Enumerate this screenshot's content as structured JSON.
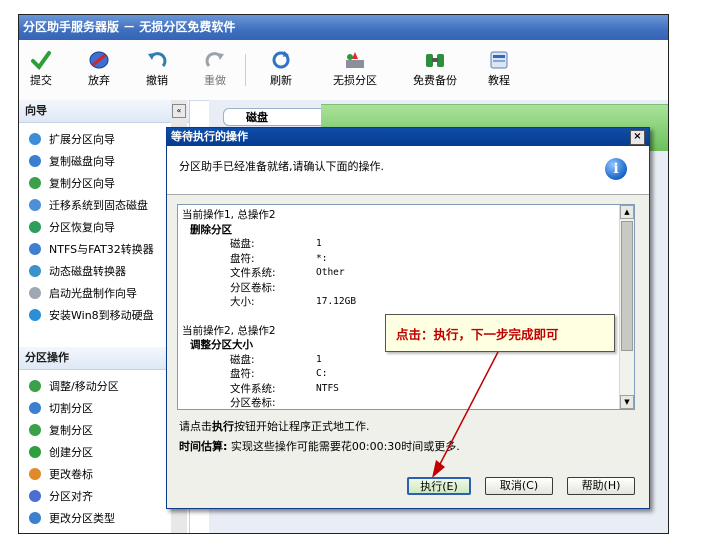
{
  "window": {
    "title": "分区助手服务器版 － 无损分区免费软件"
  },
  "toolbar": {
    "items": [
      {
        "label": "提交",
        "icon": "check-icon"
      },
      {
        "label": "放弃",
        "icon": "discard-icon"
      },
      {
        "label": "撤销",
        "icon": "undo-icon"
      },
      {
        "label": "重做",
        "icon": "redo-icon"
      },
      {
        "label": "刷新",
        "icon": "refresh-icon"
      },
      {
        "label": "无损分区",
        "icon": "partition-icon"
      },
      {
        "label": "免费备份",
        "icon": "backup-icon"
      },
      {
        "label": "教程",
        "icon": "tutorial-icon"
      }
    ]
  },
  "sidebar": {
    "wizard_header": "向导",
    "wizard_items": [
      "扩展分区向导",
      "复制磁盘向导",
      "复制分区向导",
      "迁移系统到固态磁盘",
      "分区恢复向导",
      "NTFS与FAT32转换器",
      "动态磁盘转换器",
      "启动光盘制作向导",
      "安装Win8到移动硬盘"
    ],
    "ops_header": "分区操作",
    "ops_items": [
      "调整/移动分区",
      "切割分区",
      "复制分区",
      "创建分区",
      "更改卷标",
      "分区对齐",
      "更改分区类型"
    ]
  },
  "rightpane": {
    "disk_label": "磁盘"
  },
  "dialog": {
    "title": "等待执行的操作",
    "close": "×",
    "info_text": "分区助手已经准备就绪,请确认下面的操作.",
    "info_icon": "i",
    "operations": [
      {
        "header": "当前操作1, 总操作2",
        "name": "删除分区",
        "fields": [
          {
            "key": "磁盘:",
            "value": "1"
          },
          {
            "key": "盘符:",
            "value": "*:"
          },
          {
            "key": "文件系统:",
            "value": "Other"
          },
          {
            "key": "分区卷标:",
            "value": ""
          },
          {
            "key": "大小:",
            "value": "17.12GB"
          }
        ]
      },
      {
        "header": "当前操作2, 总操作2",
        "name": "调整分区大小",
        "fields": [
          {
            "key": "磁盘:",
            "value": "1"
          },
          {
            "key": "盘符:",
            "value": "C:"
          },
          {
            "key": "文件系统:",
            "value": "NTFS"
          },
          {
            "key": "分区卷标:",
            "value": ""
          }
        ]
      }
    ],
    "note_pre": "请点击",
    "note_bold": "执行",
    "note_post": "按钮开始让程序正式地工作.",
    "estimate_label": "时间估算:",
    "estimate_text": " 实现这些操作可能需要花00:00:30时间或更多.",
    "buttons": {
      "execute": "执行(E)",
      "cancel": "取消(C)",
      "help": "帮助(H)"
    }
  },
  "callout": {
    "text": "点击：执行，下一步完成即可"
  },
  "colors": {
    "title_bar": "#3f6fbf",
    "dialog_title": "#0a47a0",
    "callout_text": "#c00000",
    "arrow": "#c00000"
  }
}
